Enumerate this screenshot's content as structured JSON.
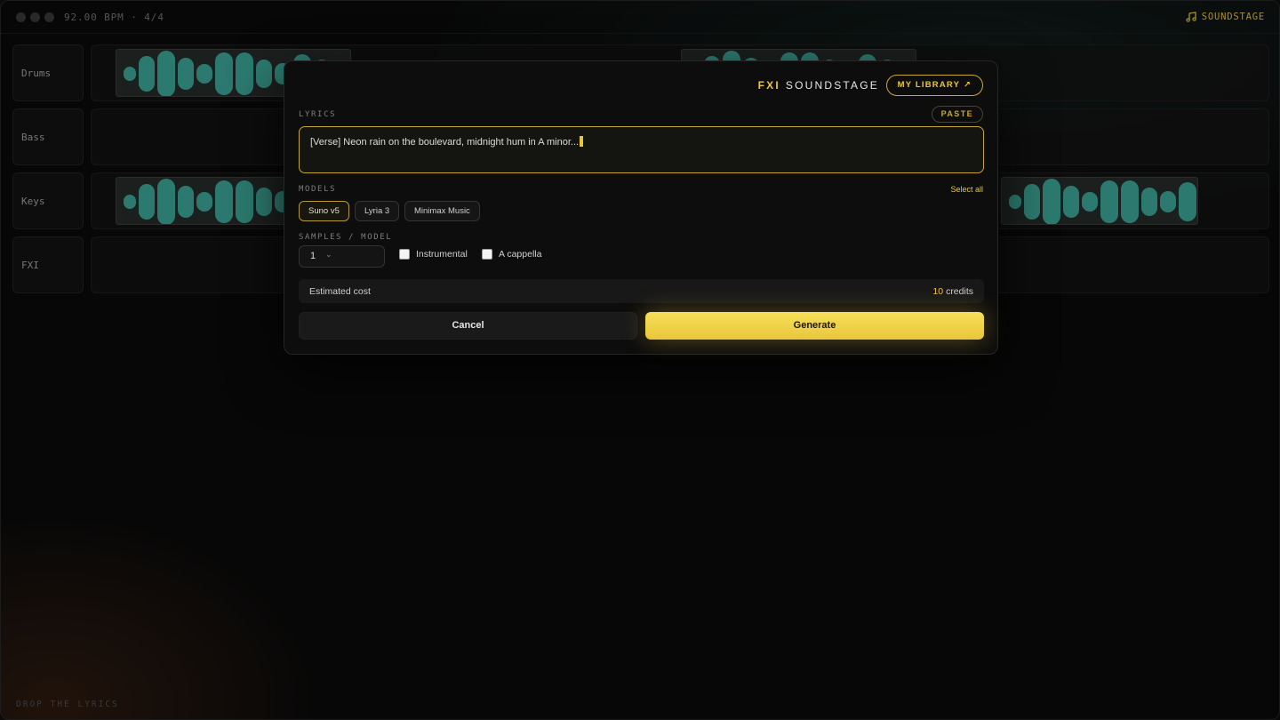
{
  "topbar": {
    "tempo": "92.00 BPM · 4/4",
    "brand": "SOUNDSTAGE",
    "brand_icon": "music-note-icon"
  },
  "tracks": [
    {
      "label": "Drums"
    },
    {
      "label": "Bass"
    },
    {
      "label": "Keys"
    },
    {
      "label": "FXI"
    }
  ],
  "modal": {
    "brand_prefix": "FXI",
    "brand_name": "SOUNDSTAGE",
    "library_button": "MY LIBRARY ↗",
    "lyrics_label": "LYRICS",
    "paste_button": "PASTE",
    "lyrics_value": "[Verse] Neon rain on the boulevard, midnight hum in A minor...",
    "models_label": "MODELS",
    "select_all": "Select all",
    "models": [
      {
        "label": "Suno v5",
        "selected": true
      },
      {
        "label": "Lyria 3",
        "selected": false
      },
      {
        "label": "Minimax Music",
        "selected": false
      }
    ],
    "samples_label": "SAMPLES / MODEL",
    "samples_value": "1",
    "samples_chevron": "⌄",
    "instrumental_label": "Instrumental",
    "acappella_label": "A cappella",
    "cost_label": "Estimated cost",
    "cost_value": "10",
    "cost_unit": "credits",
    "cancel_button": "Cancel",
    "generate_button": "Generate"
  },
  "footer": {
    "tagline": "DROP THE LYRICS"
  },
  "colors": {
    "accent": "#e9c63c",
    "waveform": "#3ea99a",
    "background": "#0b0b0b"
  }
}
